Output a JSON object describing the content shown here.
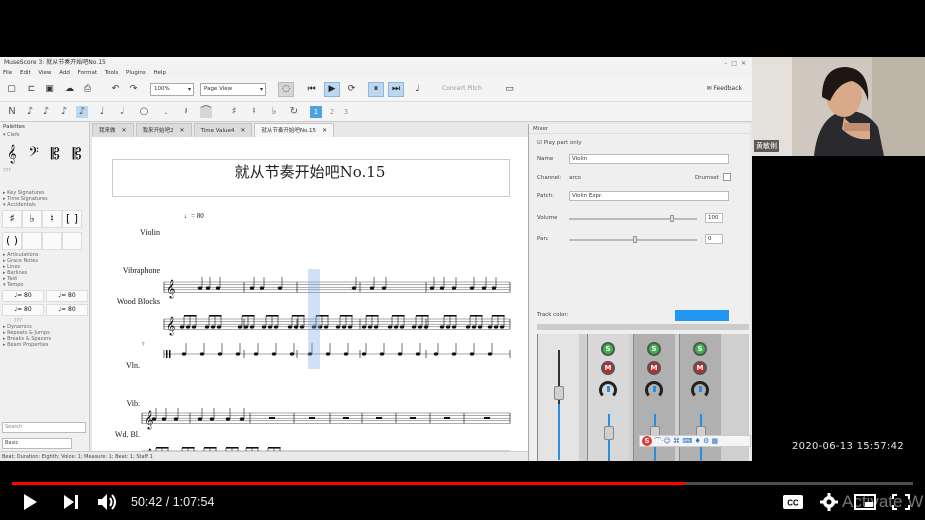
{
  "app": {
    "title": "MuseScore 3: 就从节奏开始吧No.15",
    "menu": [
      "File",
      "Edit",
      "View",
      "Add",
      "Format",
      "Tools",
      "Plugins",
      "Help"
    ],
    "zoom": "100%",
    "view_mode": "Page View",
    "concert_pitch": "Concert Pitch",
    "feedback": "Feedback"
  },
  "palettes": {
    "header": "Palettes",
    "clefs_label": "Clefs",
    "items_top": [
      "Key Signatures",
      "Time Signatures",
      "Accidentals"
    ],
    "items_mid": [
      "Articulations",
      "Grace Notes",
      "Lines",
      "Barlines",
      "Text",
      "Tempo"
    ],
    "tempo_marks": [
      "♩= 80",
      "♩= 80",
      "♩= 80",
      "♩= 80"
    ],
    "more": "???",
    "items_bottom": [
      "Dynamics",
      "Repeats & Jumps",
      "Breaks & Spacers",
      "Beam Properties"
    ],
    "search_placeholder": "Search",
    "workspace": "Basic"
  },
  "tabs": [
    {
      "label": "我来做",
      "active": false
    },
    {
      "label": "我来开始吧2",
      "active": false
    },
    {
      "label": "Time Value4",
      "active": false
    },
    {
      "label": "就从节奏开始吧No.15",
      "active": true
    }
  ],
  "score": {
    "title": "就从节奏开始吧No.15",
    "tempo": "♩= 80",
    "instruments": [
      "Violin",
      "Vibraphone",
      "Wood Blocks"
    ],
    "instruments_short": [
      "Vln.",
      "Vib.",
      "Wd. Bl."
    ],
    "system2_measure": "7"
  },
  "statusbar": "Beat; Duration: Eighth; Voice: 1;  Measure: 1; Beat: 1; Staff 1",
  "mixer": {
    "title": "Mixer",
    "play_part_only": "Play part only",
    "name_label": "Name",
    "name_value": "Violin",
    "channel_label": "Channel:",
    "channel_value": "arco",
    "drumset_label": "Drumset",
    "patch_label": "Patch:",
    "patch_value": "Violin Expr.",
    "volume_label": "Volume",
    "volume_value": "100",
    "volume_fraction": 0.79,
    "pan_label": "Pan:",
    "pan_value": "0",
    "pan_fraction": 0.5,
    "track_color_label": "Track color:",
    "track_color": "#2196f3"
  },
  "webcam": {
    "name": "黄敏俐"
  },
  "recording_timestamp": "2020-06-13  15:57:42",
  "player": {
    "current_time": "50:42",
    "duration": "1:07:54",
    "time_display": "50:42 / 1:07:54",
    "progress": 0.7466,
    "progress_color": "#ff0000",
    "watermark": "Activate W"
  }
}
